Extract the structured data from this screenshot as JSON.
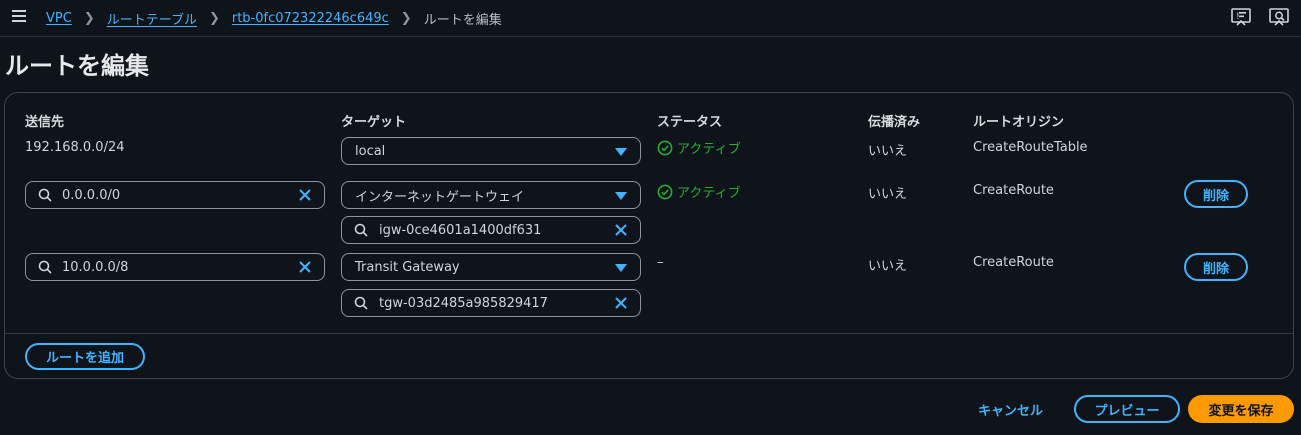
{
  "breadcrumb": {
    "vpc": "VPC",
    "route_tables": "ルートテーブル",
    "rtb_id": "rtb-0fc072322246c649c",
    "current": "ルートを編集"
  },
  "page": {
    "title": "ルートを編集"
  },
  "table": {
    "headers": {
      "destination": "送信先",
      "target": "ターゲット",
      "status": "ステータス",
      "propagated": "伝播済み",
      "route_origin": "ルートオリジン"
    },
    "rows": [
      {
        "destination": "192.168.0.0/24",
        "target_type": "local",
        "target_id": "",
        "status": "アクティブ",
        "propagated": "いいえ",
        "origin": "CreateRouteTable"
      },
      {
        "destination": "0.0.0.0/0",
        "target_type": "インターネットゲートウェイ",
        "target_id": "igw-0ce4601a1400df631",
        "status": "アクティブ",
        "propagated": "いいえ",
        "origin": "CreateRoute",
        "delete_label": "削除"
      },
      {
        "destination": "10.0.0.0/8",
        "target_type": "Transit Gateway",
        "target_id": "tgw-03d2485a985829417",
        "status": "–",
        "propagated": "いいえ",
        "origin": "CreateRoute",
        "delete_label": "削除"
      }
    ],
    "add_route_label": "ルートを追加"
  },
  "footer": {
    "cancel_label": "キャンセル",
    "preview_label": "プレビュー",
    "save_label": "変更を保存"
  },
  "colors": {
    "accent": "#42b4ff",
    "success": "#29ad32",
    "primary": "#ff9900",
    "background": "#0f141a"
  }
}
